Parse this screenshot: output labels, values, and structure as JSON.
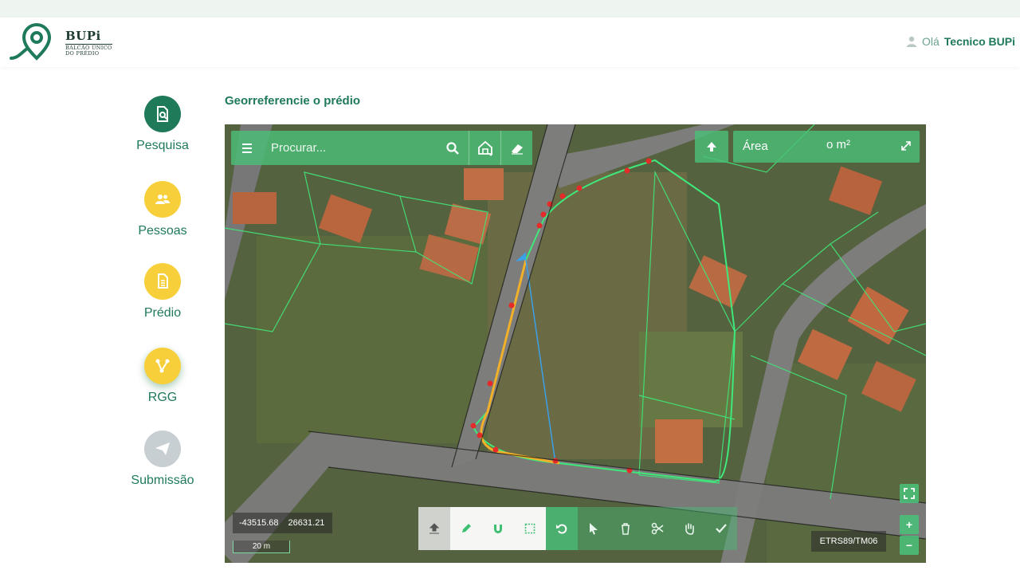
{
  "header": {
    "brand_name": "BUPi",
    "brand_sub_1": "BALCÃO ÚNICO",
    "brand_sub_2": "DO PRÉDIO",
    "greeting": "Olá",
    "user_name": "Tecnico BUPi"
  },
  "sidebar": {
    "items": [
      {
        "label": "Pesquisa",
        "icon": "search-document-icon",
        "color": "#1f7a5a"
      },
      {
        "label": "Pessoas",
        "icon": "people-icon",
        "color": "#f7cf3a"
      },
      {
        "label": "Prédio",
        "icon": "document-icon",
        "color": "#f7cf3a"
      },
      {
        "label": "RGG",
        "icon": "path-icon",
        "color": "#f7cf3a"
      },
      {
        "label": "Submissão",
        "icon": "send-icon",
        "color": "#c8cfd3"
      }
    ]
  },
  "page": {
    "title": "Georreferencie o prédio"
  },
  "map": {
    "search_placeholder": "Procurar...",
    "area_label": "Área",
    "area_value": "o m²",
    "coord_x": "-43515.68",
    "coord_y": "26631.21",
    "scale_label": "20 m",
    "crs": "ETRS89/TM06",
    "zoom_in": "+",
    "zoom_out": "−"
  },
  "toolbar": {
    "tools": [
      "upload-icon",
      "pencil-icon",
      "magnet-icon",
      "select-box-icon",
      "undo-icon",
      "pointer-icon",
      "trash-icon",
      "scissors-icon",
      "hand-icon",
      "check-icon"
    ]
  },
  "colors": {
    "accent": "#1f7a5a",
    "map_panel": "#4abe78",
    "pending": "#f7cf3a",
    "disabled": "#c8cfd3"
  }
}
